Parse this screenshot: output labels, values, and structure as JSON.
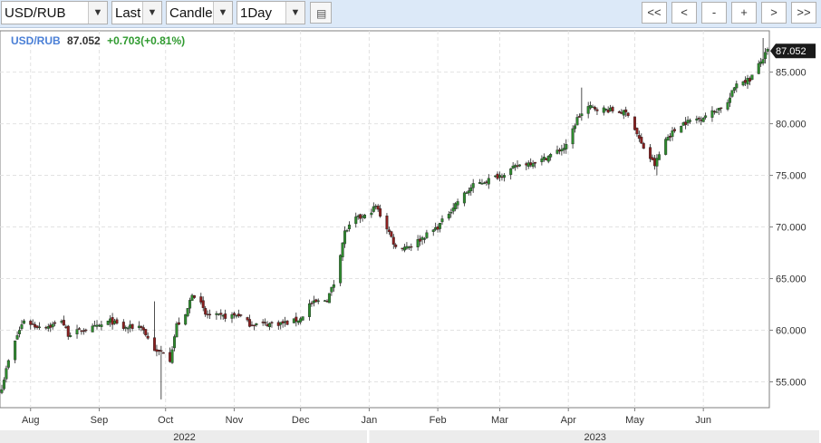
{
  "toolbar": {
    "symbol": "USD/RUB",
    "price_field": "Last",
    "chart_type": "Candle",
    "interval": "1Day",
    "icon": "table-icon",
    "nav": {
      "first": "<<",
      "prev": "<",
      "zoom_out": "-",
      "zoom_in": "+",
      "next": ">",
      "last": ">>"
    }
  },
  "legend": {
    "symbol": "USD/RUB",
    "price": "87.052",
    "change": "+0.703(+0.81%)"
  },
  "last_price_tag": "87.052",
  "colors": {
    "up": "#2e8b2e",
    "down": "#8b1f1f",
    "symbol_text": "#4a7fd6",
    "change_text": "#2f9a2f",
    "grid": "#e2e2e2"
  },
  "chart_data": {
    "type": "candlestick",
    "title": "",
    "xlabel": "",
    "ylabel": "",
    "ylim": [
      52.5,
      89
    ],
    "yticks": [
      "55.000",
      "60.000",
      "65.000",
      "70.000",
      "75.000",
      "80.000",
      "85.000"
    ],
    "ytick_values": [
      55,
      60,
      65,
      70,
      75,
      80,
      85
    ],
    "x_range": [
      "2022-07-19",
      "2023-06-30"
    ],
    "xticks": [
      {
        "label": "Aug",
        "date": "2022-08-01"
      },
      {
        "label": "Sep",
        "date": "2022-09-01"
      },
      {
        "label": "Oct",
        "date": "2022-10-01"
      },
      {
        "label": "Nov",
        "date": "2022-11-01"
      },
      {
        "label": "Dec",
        "date": "2022-12-01"
      },
      {
        "label": "Jan",
        "date": "2023-01-01"
      },
      {
        "label": "Feb",
        "date": "2023-02-01"
      },
      {
        "label": "Mar",
        "date": "2023-03-01"
      },
      {
        "label": "Apr",
        "date": "2023-04-01"
      },
      {
        "label": "May",
        "date": "2023-05-01"
      },
      {
        "label": "Jun",
        "date": "2023-06-01"
      }
    ],
    "years": [
      {
        "label": "2022",
        "from": "2022-07-19",
        "to": "2022-12-31"
      },
      {
        "label": "2023",
        "from": "2023-01-01",
        "to": "2023-06-30"
      }
    ],
    "anchors": [
      [
        "2022-07-19",
        54.5
      ],
      [
        "2022-07-22",
        57.0
      ],
      [
        "2022-07-26",
        59.5
      ],
      [
        "2022-07-29",
        61.0
      ],
      [
        "2022-08-03",
        60.4
      ],
      [
        "2022-08-10",
        60.4
      ],
      [
        "2022-08-15",
        61.0
      ],
      [
        "2022-08-18",
        59.6
      ],
      [
        "2022-08-24",
        60.0
      ],
      [
        "2022-08-31",
        60.3
      ],
      [
        "2022-09-06",
        60.9
      ],
      [
        "2022-09-12",
        60.2
      ],
      [
        "2022-09-20",
        60.4
      ],
      [
        "2022-09-23",
        59.2
      ],
      [
        "2022-09-27",
        57.8
      ],
      [
        "2022-09-30",
        58.0
      ],
      [
        "2022-10-03",
        57.2
      ],
      [
        "2022-10-06",
        60.5
      ],
      [
        "2022-10-10",
        61.3
      ],
      [
        "2022-10-13",
        63.6
      ],
      [
        "2022-10-16",
        63.0
      ],
      [
        "2022-10-19",
        61.5
      ],
      [
        "2022-10-27",
        61.3
      ],
      [
        "2022-11-03",
        61.5
      ],
      [
        "2022-11-08",
        60.6
      ],
      [
        "2022-11-15",
        60.6
      ],
      [
        "2022-11-25",
        60.7
      ],
      [
        "2022-12-01",
        61.1
      ],
      [
        "2022-12-05",
        62.5
      ],
      [
        "2022-12-13",
        63.0
      ],
      [
        "2022-12-16",
        64.5
      ],
      [
        "2022-12-21",
        69.5
      ],
      [
        "2022-12-26",
        70.8
      ],
      [
        "2022-12-30",
        71.0
      ],
      [
        "2023-01-04",
        72.0
      ],
      [
        "2023-01-10",
        69.5
      ],
      [
        "2023-01-13",
        68.0
      ],
      [
        "2023-01-20",
        68.2
      ],
      [
        "2023-02-01",
        70.0
      ],
      [
        "2023-02-10",
        72.5
      ],
      [
        "2023-02-17",
        74.0
      ],
      [
        "2023-03-01",
        75.0
      ],
      [
        "2023-03-10",
        76.0
      ],
      [
        "2023-03-20",
        76.5
      ],
      [
        "2023-03-31",
        77.8
      ],
      [
        "2023-04-05",
        80.5
      ],
      [
        "2023-04-10",
        81.6
      ],
      [
        "2023-04-20",
        81.3
      ],
      [
        "2023-04-28",
        81.0
      ],
      [
        "2023-05-04",
        78.0
      ],
      [
        "2023-05-10",
        76.0
      ],
      [
        "2023-05-15",
        78.5
      ],
      [
        "2023-05-22",
        80.0
      ],
      [
        "2023-05-31",
        80.6
      ],
      [
        "2023-06-05",
        81.1
      ],
      [
        "2023-06-12",
        82.0
      ],
      [
        "2023-06-16",
        84.0
      ],
      [
        "2023-06-22",
        84.3
      ],
      [
        "2023-06-27",
        86.0
      ],
      [
        "2023-06-30",
        87.05
      ]
    ],
    "spikes": [
      {
        "date": "2022-09-29",
        "low": 53.3
      },
      {
        "date": "2022-09-26",
        "high": 62.8
      },
      {
        "date": "2023-04-07",
        "high": 83.5
      },
      {
        "date": "2023-05-11",
        "low": 75.0
      },
      {
        "date": "2023-06-28",
        "high": 88.3
      }
    ]
  }
}
